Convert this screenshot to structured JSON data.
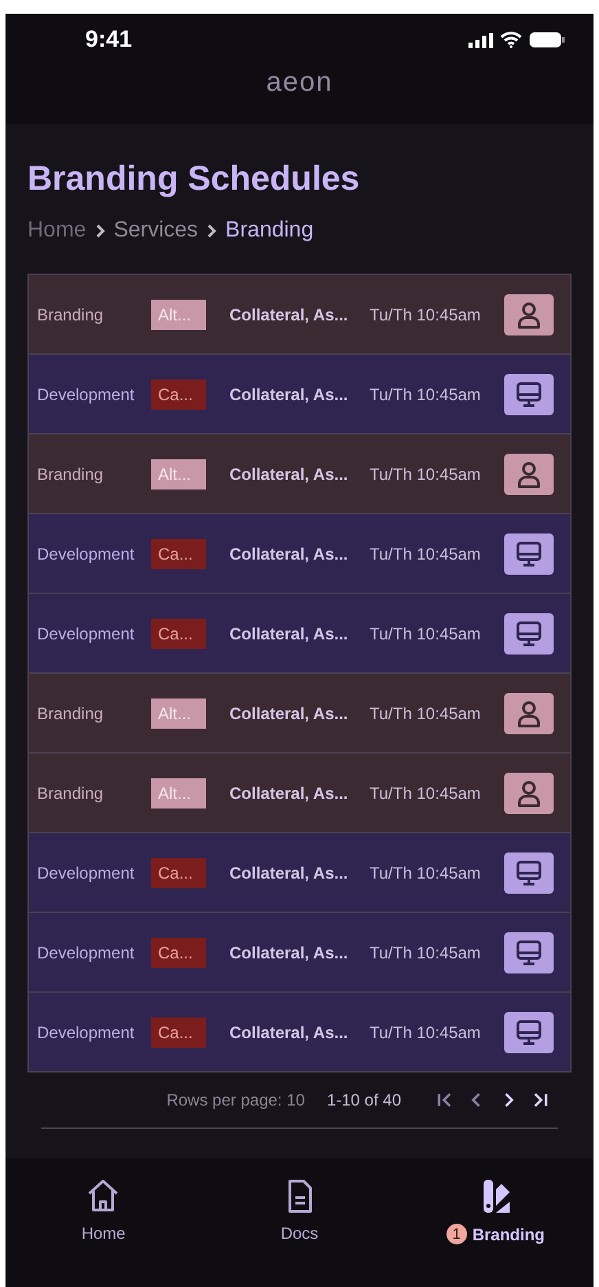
{
  "status_bar": {
    "time": "9:41"
  },
  "header": {
    "logo": "aeon"
  },
  "page": {
    "title": "Branding Schedules",
    "breadcrumb": [
      {
        "label": "Home",
        "current": false
      },
      {
        "label": "Services",
        "current": false
      },
      {
        "label": "Branding",
        "current": true
      }
    ]
  },
  "table": {
    "rows": [
      {
        "kind": "branding",
        "category": "Branding",
        "tag": "Alt...",
        "title": "Collateral, As...",
        "time": "Tu/Th 10:45am"
      },
      {
        "kind": "development",
        "category": "Development",
        "tag": "Ca...",
        "title": "Collateral, As...",
        "time": "Tu/Th 10:45am"
      },
      {
        "kind": "branding",
        "category": "Branding",
        "tag": "Alt...",
        "title": "Collateral, As...",
        "time": "Tu/Th 10:45am"
      },
      {
        "kind": "development",
        "category": "Development",
        "tag": "Ca...",
        "title": "Collateral, As...",
        "time": "Tu/Th 10:45am"
      },
      {
        "kind": "development",
        "category": "Development",
        "tag": "Ca...",
        "title": "Collateral, As...",
        "time": "Tu/Th 10:45am"
      },
      {
        "kind": "branding",
        "category": "Branding",
        "tag": "Alt...",
        "title": "Collateral, As...",
        "time": "Tu/Th 10:45am"
      },
      {
        "kind": "branding",
        "category": "Branding",
        "tag": "Alt...",
        "title": "Collateral, As...",
        "time": "Tu/Th 10:45am"
      },
      {
        "kind": "development",
        "category": "Development",
        "tag": "Ca...",
        "title": "Collateral, As...",
        "time": "Tu/Th 10:45am"
      },
      {
        "kind": "development",
        "category": "Development",
        "tag": "Ca...",
        "title": "Collateral, As...",
        "time": "Tu/Th 10:45am"
      },
      {
        "kind": "development",
        "category": "Development",
        "tag": "Ca...",
        "title": "Collateral, As...",
        "time": "Tu/Th 10:45am"
      }
    ]
  },
  "pagination": {
    "rows_per_page": "Rows per page: 10",
    "range": "1-10 of 40",
    "buttons": [
      {
        "kind": "first",
        "disabled": true
      },
      {
        "kind": "prev",
        "disabled": true
      },
      {
        "kind": "next",
        "disabled": false
      },
      {
        "kind": "last",
        "disabled": false
      }
    ]
  },
  "bottom_nav": [
    {
      "kind": "home",
      "label": "Home",
      "selected": false
    },
    {
      "kind": "docs",
      "label": "Docs",
      "selected": false
    },
    {
      "kind": "branding",
      "label": "Branding",
      "selected": true,
      "badge": "1"
    }
  ]
}
